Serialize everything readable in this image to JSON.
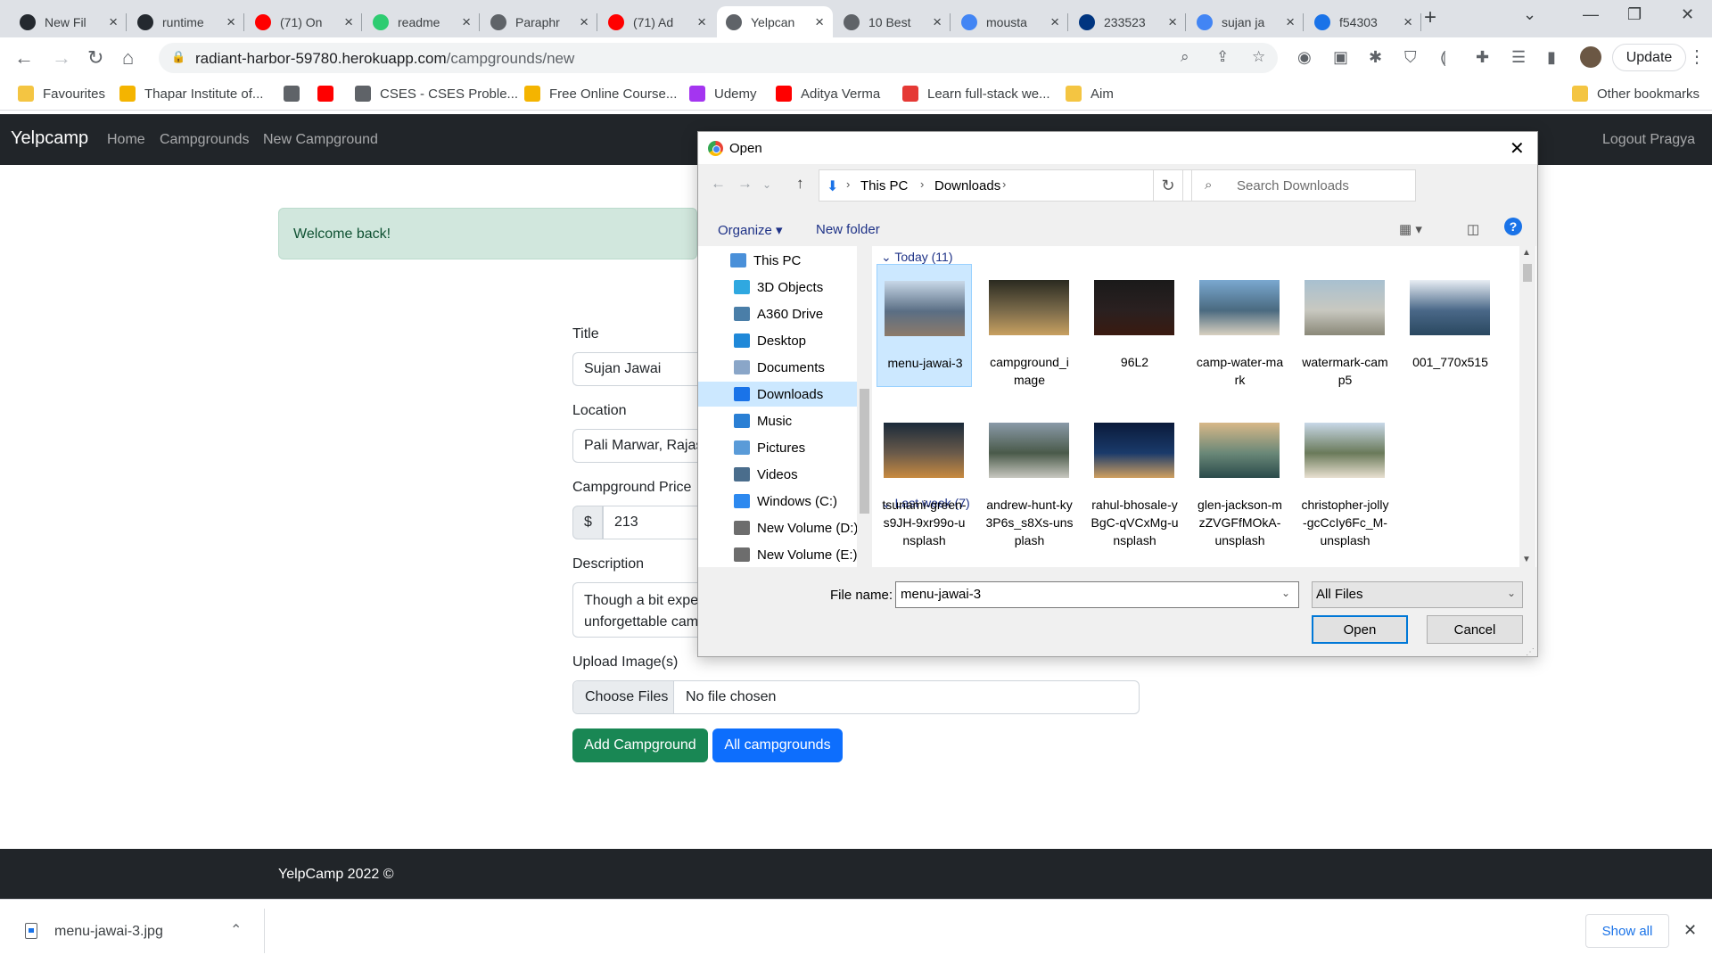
{
  "tabs": [
    {
      "title": "New Fil",
      "color": "#24292f"
    },
    {
      "title": "runtime",
      "color": "#24292f"
    },
    {
      "title": "(71) On",
      "color": "#ff0000"
    },
    {
      "title": "readme",
      "color": "#2ecc71"
    },
    {
      "title": "Paraphr",
      "color": "#5f6368"
    },
    {
      "title": "(71) Ad",
      "color": "#ff0000"
    },
    {
      "title": "Yelpcan",
      "color": "#5f6368"
    },
    {
      "title": "10 Best",
      "color": "#5f6368"
    },
    {
      "title": "mousta",
      "color": "#4285f4"
    },
    {
      "title": "233523",
      "color": "#003580"
    },
    {
      "title": "sujan ja",
      "color": "#4285f4"
    },
    {
      "title": "f54303",
      "color": "#1a73e8"
    }
  ],
  "browser": {
    "url_host": "radiant-harbor-59780.herokuapp.com",
    "url_path": "/campgrounds/new",
    "update_label": "Update"
  },
  "bookmarks": [
    {
      "label": "Favourites",
      "color": "#f4c542"
    },
    {
      "label": "Thapar Institute of...",
      "color": "#f4b400"
    },
    {
      "label": "",
      "color": "#5f6368"
    },
    {
      "label": "",
      "color": "#ff0000"
    },
    {
      "label": "CSES - CSES Proble...",
      "color": "#5f6368"
    },
    {
      "label": "Free Online Course...",
      "color": "#f4b400"
    },
    {
      "label": "Udemy",
      "color": "#a435f0"
    },
    {
      "label": "Aditya Verma",
      "color": "#ff0000"
    },
    {
      "label": "Learn full-stack we...",
      "color": "#e53935"
    },
    {
      "label": "Aim",
      "color": "#f4c542"
    },
    {
      "label": "Other bookmarks",
      "color": "#f4c542"
    }
  ],
  "app": {
    "brand": "Yelpcamp",
    "nav": [
      "Home",
      "Campgrounds",
      "New Campground"
    ],
    "logout": "Logout Pragya",
    "flash": "Welcome back!",
    "form": {
      "title_label": "Title",
      "title_value": "Sujan Jawai",
      "location_label": "Location",
      "location_value": "Pali Marwar, Rajast",
      "price_label": "Campground Price",
      "currency": "$",
      "price_value": "213",
      "description_label": "Description",
      "description_line1": "Though a bit expe",
      "description_line2": "unforgettable cam",
      "upload_label": "Upload Image(s)",
      "choose_files": "Choose Files",
      "no_file": "No file chosen",
      "add_button": "Add Campground",
      "all_button": "All campgrounds",
      "add_color": "#198754",
      "all_color": "#0d6efd"
    },
    "footer": "YelpCamp 2022 ©"
  },
  "downloads": {
    "file": "menu-jawai-3.jpg",
    "show_all": "Show all"
  },
  "dialog": {
    "title": "Open",
    "path": [
      "This PC",
      "Downloads"
    ],
    "search_placeholder": "Search Downloads",
    "organize": "Organize",
    "new_folder": "New folder",
    "tree": [
      {
        "label": "This PC",
        "color": "#4a90d9"
      },
      {
        "label": "3D Objects",
        "color": "#2fa8e0"
      },
      {
        "label": "A360 Drive",
        "color": "#4a7ea8"
      },
      {
        "label": "Desktop",
        "color": "#1f88d8"
      },
      {
        "label": "Documents",
        "color": "#8aa6c8"
      },
      {
        "label": "Downloads",
        "color": "#1a73e8",
        "selected": true
      },
      {
        "label": "Music",
        "color": "#2a7fd4"
      },
      {
        "label": "Pictures",
        "color": "#5a9bd8"
      },
      {
        "label": "Videos",
        "color": "#4a6d8c"
      },
      {
        "label": "Windows (C:)",
        "color": "#2d89ef"
      },
      {
        "label": "New Volume (D:)",
        "color": "#6d6d6d"
      },
      {
        "label": "New Volume (E:)",
        "color": "#6d6d6d"
      }
    ],
    "group_today": "Today (11)",
    "group_last_week": "Last week (7)",
    "files": [
      {
        "name": "menu-jawai-3",
        "colors": [
          "#c8d8e8",
          "#5a6e84",
          "#8c7a6a"
        ],
        "selected": true
      },
      {
        "name": "campground_image",
        "colors": [
          "#2a2a20",
          "#7a6a4a",
          "#c8a060"
        ]
      },
      {
        "name": "96L2",
        "colors": [
          "#1a1a1a",
          "#2a2020",
          "#3a1a10"
        ]
      },
      {
        "name": "camp-water-mark",
        "colors": [
          "#7aa8d0",
          "#4a6a80",
          "#d8d0c0"
        ]
      },
      {
        "name": "watermark-camp5",
        "colors": [
          "#a8c0d0",
          "#c8c8c0",
          "#8a8878"
        ]
      },
      {
        "name": "001_770x515",
        "colors": [
          "#e8eef4",
          "#4a6888",
          "#2a4860"
        ]
      },
      {
        "name": "tsunami-green-s9JH-9xr99o-unsplash",
        "colors": [
          "#1a2a3a",
          "#6a5a4a",
          "#c88a40"
        ]
      },
      {
        "name": "andrew-hunt-ky3P6s_s8Xs-unsplash",
        "colors": [
          "#8a9aa8",
          "#4a5a4a",
          "#c8c8c0"
        ]
      },
      {
        "name": "rahul-bhosale-yBgC-qVCxMg-unsplash",
        "colors": [
          "#0a1a3a",
          "#1a3a6a",
          "#d0a060"
        ]
      },
      {
        "name": "glen-jackson-mzZVGFfMOkA-unsplash",
        "colors": [
          "#d8b888",
          "#6a8878",
          "#2a4a4a"
        ]
      },
      {
        "name": "christopher-jolly-gcCcIy6Fc_M-unsplash",
        "colors": [
          "#c8d8e8",
          "#6a7a5a",
          "#e8e0d0"
        ]
      }
    ],
    "file_name_label": "File name:",
    "file_name_value": "menu-jawai-3",
    "file_type": "All Files",
    "open": "Open",
    "cancel": "Cancel"
  }
}
